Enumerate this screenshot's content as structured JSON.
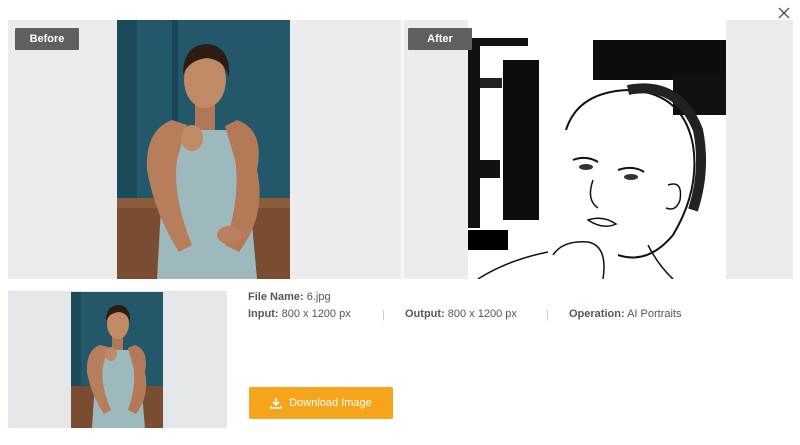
{
  "dialog": {
    "close_icon": "close-icon"
  },
  "compare": {
    "before_label": "Before",
    "after_label": "After"
  },
  "file_info": {
    "file_name_label": "File Name:",
    "file_name": "6.jpg",
    "input_label": "Input:",
    "input_value": "800 x 1200 px",
    "output_label": "Output:",
    "output_value": "800 x 1200 px",
    "operation_label": "Operation:",
    "operation_value": "AI Portraits",
    "separator": "|"
  },
  "download": {
    "label": "Download Image",
    "icon": "download-icon"
  },
  "colors": {
    "accent": "#f5a41c",
    "tag_bg": "#5f5f5f",
    "label_text": "#4f5a68"
  }
}
